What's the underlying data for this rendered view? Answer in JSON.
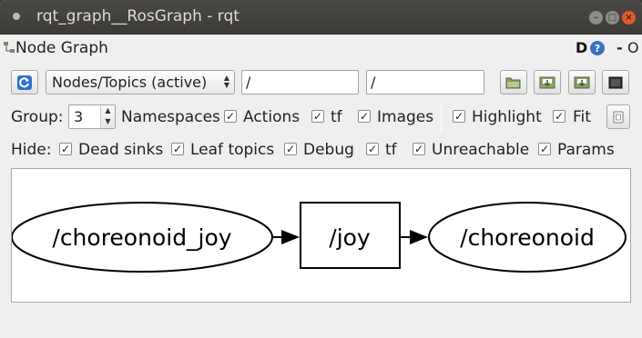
{
  "window": {
    "title": "rqt_graph__RosGraph - rqt"
  },
  "plugin": {
    "title": "Node Graph",
    "help_d": "D",
    "help_q": "?",
    "dash": "-",
    "close_o": "O"
  },
  "toolbar": {
    "mode_selected": "Nodes/Topics (active)",
    "node_filter": "/",
    "topic_filter": "/"
  },
  "row2": {
    "group_label": "Group:",
    "group_value": "3",
    "namespaces_label": "Namespaces",
    "namespaces_checked": true,
    "actions_label": "Actions",
    "actions_checked": true,
    "tf_label": "tf",
    "tf_checked": true,
    "images_label": "Images",
    "images_checked": true,
    "highlight_label": "Highlight",
    "highlight_checked": true,
    "fit_label": "Fit",
    "fit_checked": true
  },
  "hide": {
    "label": "Hide:",
    "dead_sinks": "Dead sinks",
    "leaf_topics": "Leaf topics",
    "debug": "Debug",
    "tf": "tf",
    "unreachable": "Unreachable",
    "params": "Params"
  },
  "graph": {
    "nodes": [
      {
        "label": "/choreonoid_joy",
        "shape": "ellipse"
      },
      {
        "label": "/joy",
        "shape": "box"
      },
      {
        "label": "/choreonoid",
        "shape": "ellipse"
      }
    ]
  },
  "colors": {
    "titlebar": "#3c3b37",
    "close_button": "#e4582a",
    "help_icon": "#3a6fc4",
    "window_bg": "#efefef"
  }
}
